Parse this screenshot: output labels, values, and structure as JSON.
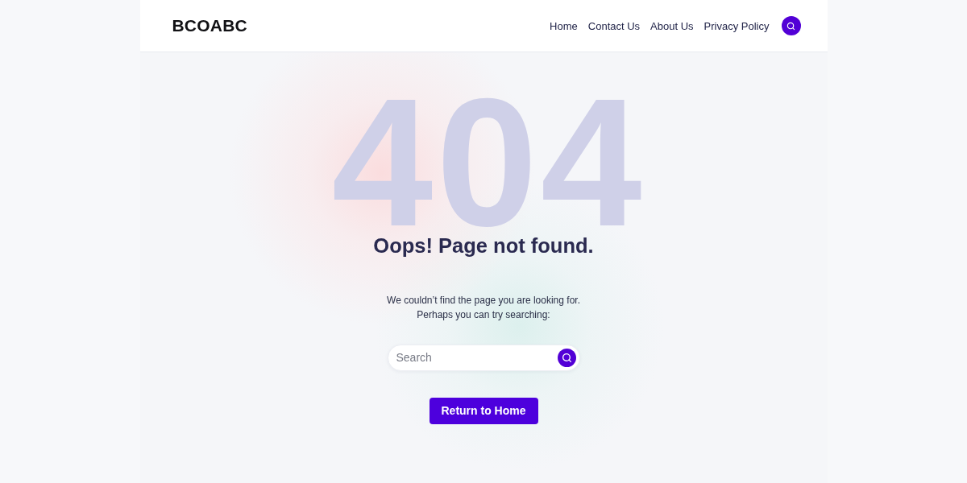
{
  "header": {
    "logo": "BCOABC",
    "nav": [
      {
        "label": "Home"
      },
      {
        "label": "Contact Us"
      },
      {
        "label": "About Us"
      },
      {
        "label": "Privacy Policy"
      }
    ]
  },
  "error": {
    "code": "404",
    "title": "Oops! Page not found.",
    "message": "We couldn’t find the page you are looking for.",
    "prompt": "Perhaps you can try searching:"
  },
  "search": {
    "placeholder": "Search"
  },
  "button": {
    "label": "Return to Home"
  }
}
